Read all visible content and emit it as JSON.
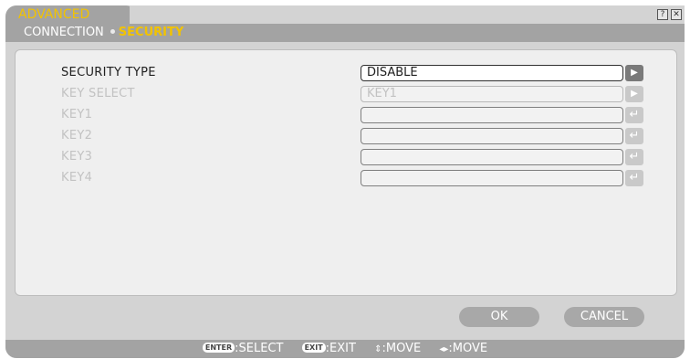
{
  "window": {
    "tab_label": "ADVANCED",
    "help_icon": "?",
    "close_icon": "✕"
  },
  "breadcrumb": {
    "parent": "CONNECTION",
    "current": "SECURITY"
  },
  "form": {
    "rows": [
      {
        "label": "SECURITY TYPE",
        "value": "DISABLE",
        "button_icon": "▶",
        "state": "active"
      },
      {
        "label": "KEY SELECT",
        "value": "KEY1",
        "button_icon": "▶",
        "state": "disabled"
      },
      {
        "label": "KEY1",
        "value": "",
        "button_icon": "↵",
        "state": "disabled"
      },
      {
        "label": "KEY2",
        "value": "",
        "button_icon": "↵",
        "state": "disabled"
      },
      {
        "label": "KEY3",
        "value": "",
        "button_icon": "↵",
        "state": "disabled"
      },
      {
        "label": "KEY4",
        "value": "",
        "button_icon": "↵",
        "state": "disabled"
      }
    ]
  },
  "buttons": {
    "ok": "OK",
    "cancel": "CANCEL"
  },
  "footer": {
    "enter_key": "ENTER",
    "enter_action": ":SELECT",
    "exit_key": "EXIT",
    "exit_action": ":EXIT",
    "updown_glyph": "⇕",
    "updown_action": ":MOVE",
    "leftright_glyph": "◂▸",
    "leftright_action": ":MOVE"
  },
  "colors": {
    "accent": "#f2c300",
    "bar": "#a3a3a3",
    "panel": "#efefef"
  },
  "icons": {
    "help": "help-icon",
    "close": "close-icon",
    "select_arrow": "triangle-right-icon",
    "enter": "enter-return-icon"
  }
}
